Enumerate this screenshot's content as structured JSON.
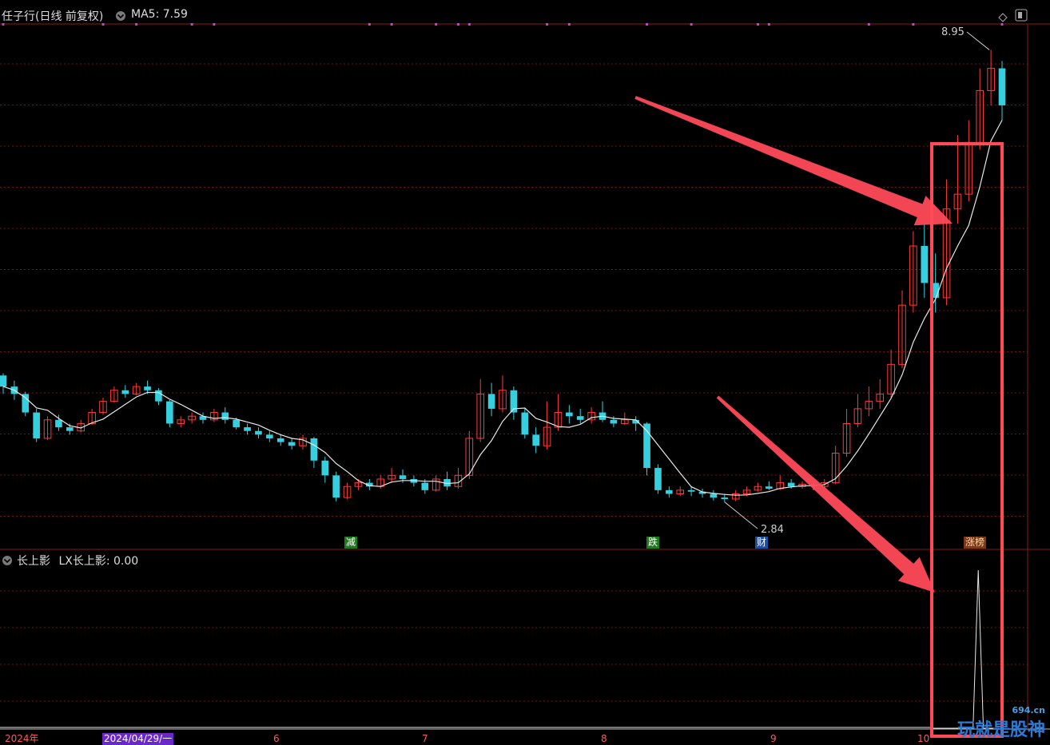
{
  "header": {
    "stock_title": "任子行(日线 前复权)",
    "ma_text": "MA5: 7.59"
  },
  "sub_header": {
    "indicator": "长上影",
    "value_text": "LX长上影: 0.00"
  },
  "annotations": {
    "high_label": "8.95",
    "low_label": "2.84"
  },
  "event_tags": [
    {
      "text": "减",
      "bg": "#1f7a1f",
      "color": "#ffffff"
    },
    {
      "text": "跌",
      "bg": "#1f7a1f",
      "color": "#ffffff"
    },
    {
      "text": "财",
      "bg": "#1f4fa0",
      "color": "#ffffff"
    },
    {
      "text": "涨榜",
      "bg": "#7a3a1a",
      "color": "#ffd0a0"
    }
  ],
  "date_axis": {
    "year": "2024年",
    "cursor": "2024/04/29/一",
    "months": [
      "6",
      "7",
      "8",
      "9",
      "10"
    ]
  },
  "watermark": {
    "site": "694.cn",
    "text": "玩就是股神"
  },
  "colors": {
    "up": "#ff3a3a",
    "down": "#34d0e0",
    "ma": "#e8e8e8",
    "highlight": "#ff4a5a",
    "grid": "#7a1010",
    "cursor_bg": "#6a28c8",
    "signal_dot": "#d040d0"
  },
  "chart_data": [
    {
      "type": "candlestick",
      "title": "任子行(日线 前复权)",
      "series": [
        {
          "name": "MA5",
          "last_value": 7.59
        },
        {
          "name": "K线",
          "values": [
            [
              4.55,
              4.4,
              4.58,
              4.3
            ],
            [
              4.4,
              4.3,
              4.48,
              4.22
            ],
            [
              4.3,
              4.05,
              4.33,
              4.0
            ],
            [
              4.05,
              3.7,
              4.1,
              3.65
            ],
            [
              3.7,
              3.95,
              4.0,
              3.68
            ],
            [
              3.95,
              3.85,
              4.02,
              3.8
            ],
            [
              3.85,
              3.8,
              3.9,
              3.75
            ],
            [
              3.8,
              3.9,
              3.95,
              3.78
            ],
            [
              3.9,
              4.05,
              4.1,
              3.88
            ],
            [
              4.05,
              4.2,
              4.25,
              4.02
            ],
            [
              4.2,
              4.35,
              4.4,
              4.18
            ],
            [
              4.35,
              4.3,
              4.42,
              4.25
            ],
            [
              4.3,
              4.4,
              4.45,
              4.28
            ],
            [
              4.4,
              4.35,
              4.48,
              4.3
            ],
            [
              4.35,
              4.2,
              4.38,
              4.15
            ],
            [
              4.2,
              3.9,
              4.22,
              3.85
            ],
            [
              3.9,
              3.95,
              4.0,
              3.85
            ],
            [
              3.95,
              4.0,
              4.05,
              3.9
            ],
            [
              4.0,
              3.95,
              4.05,
              3.9
            ],
            [
              3.95,
              4.05,
              4.1,
              3.92
            ],
            [
              4.05,
              3.95,
              4.12,
              3.9
            ],
            [
              3.95,
              3.85,
              3.98,
              3.82
            ],
            [
              3.85,
              3.8,
              3.9,
              3.75
            ],
            [
              3.8,
              3.75,
              3.85,
              3.7
            ],
            [
              3.75,
              3.7,
              3.8,
              3.65
            ],
            [
              3.7,
              3.65,
              3.75,
              3.6
            ],
            [
              3.65,
              3.6,
              3.7,
              3.55
            ],
            [
              3.6,
              3.7,
              3.75,
              3.55
            ],
            [
              3.7,
              3.4,
              3.72,
              3.3
            ],
            [
              3.4,
              3.2,
              3.45,
              3.1
            ],
            [
              3.2,
              2.9,
              3.25,
              2.85
            ],
            [
              2.9,
              3.05,
              3.1,
              2.88
            ],
            [
              3.05,
              3.1,
              3.15,
              3.0
            ],
            [
              3.1,
              3.05,
              3.15,
              3.0
            ],
            [
              3.05,
              3.15,
              3.2,
              3.02
            ],
            [
              3.15,
              3.2,
              3.3,
              3.1
            ],
            [
              3.2,
              3.15,
              3.28,
              3.1
            ],
            [
              3.15,
              3.1,
              3.2,
              3.05
            ],
            [
              3.1,
              3.0,
              3.15,
              2.95
            ],
            [
              3.0,
              3.15,
              3.2,
              2.98
            ],
            [
              3.15,
              3.05,
              3.25,
              3.0
            ],
            [
              3.05,
              3.2,
              3.3,
              3.02
            ],
            [
              3.2,
              3.7,
              3.8,
              3.15
            ],
            [
              3.7,
              4.3,
              4.5,
              3.65
            ],
            [
              4.3,
              4.1,
              4.45,
              4.0
            ],
            [
              4.1,
              4.35,
              4.55,
              4.05
            ],
            [
              4.35,
              4.05,
              4.4,
              3.95
            ],
            [
              4.05,
              3.75,
              4.1,
              3.7
            ],
            [
              3.75,
              3.6,
              3.85,
              3.5
            ],
            [
              3.6,
              3.85,
              4.2,
              3.55
            ],
            [
              3.85,
              4.05,
              4.3,
              3.8
            ],
            [
              4.05,
              4.0,
              4.15,
              3.9
            ],
            [
              4.0,
              3.95,
              4.1,
              3.9
            ],
            [
              3.95,
              4.05,
              4.12,
              3.9
            ],
            [
              4.05,
              3.95,
              4.2,
              3.92
            ],
            [
              3.95,
              3.9,
              4.0,
              3.85
            ],
            [
              3.9,
              3.95,
              4.05,
              3.88
            ],
            [
              3.95,
              3.9,
              4.0,
              3.8
            ],
            [
              3.9,
              3.3,
              3.92,
              3.2
            ],
            [
              3.3,
              3.0,
              3.35,
              2.95
            ],
            [
              3.0,
              2.95,
              3.05,
              2.9
            ],
            [
              2.95,
              3.0,
              3.05,
              2.92
            ],
            [
              3.0,
              2.98,
              3.05,
              2.92
            ],
            [
              2.98,
              2.95,
              3.02,
              2.9
            ],
            [
              2.95,
              2.9,
              3.0,
              2.86
            ],
            [
              2.9,
              2.88,
              2.95,
              2.84
            ],
            [
              2.88,
              2.95,
              3.0,
              2.85
            ],
            [
              2.95,
              3.0,
              3.05,
              2.92
            ],
            [
              3.0,
              3.05,
              3.1,
              2.98
            ],
            [
              3.05,
              3.02,
              3.12,
              3.0
            ],
            [
              3.02,
              3.1,
              3.2,
              3.0
            ],
            [
              3.1,
              3.05,
              3.15,
              3.02
            ],
            [
              3.05,
              3.08,
              3.12,
              3.02
            ],
            [
              3.08,
              3.05,
              3.12,
              3.0
            ],
            [
              3.05,
              3.1,
              3.15,
              3.02
            ],
            [
              3.1,
              3.5,
              3.6,
              3.08
            ],
            [
              3.5,
              3.9,
              4.1,
              3.45
            ],
            [
              3.9,
              4.1,
              4.3,
              3.85
            ],
            [
              4.1,
              4.2,
              4.4,
              4.0
            ],
            [
              4.2,
              4.3,
              4.5,
              4.1
            ],
            [
              4.3,
              4.7,
              4.9,
              4.25
            ],
            [
              4.7,
              5.5,
              5.7,
              4.65
            ],
            [
              5.5,
              6.3,
              6.5,
              5.4
            ],
            [
              6.3,
              5.8,
              6.6,
              5.6
            ],
            [
              5.8,
              5.6,
              6.2,
              5.4
            ],
            [
              5.6,
              6.8,
              7.2,
              5.5
            ],
            [
              6.8,
              7.0,
              7.8,
              6.6
            ],
            [
              7.0,
              7.7,
              8.0,
              6.9
            ],
            [
              7.7,
              8.4,
              8.7,
              7.6
            ],
            [
              8.4,
              8.7,
              8.95,
              8.2
            ],
            [
              8.7,
              8.2,
              8.8,
              8.0
            ]
          ]
        }
      ],
      "ylim": [
        2.2,
        9.3
      ],
      "x_ticks": [
        "2024年",
        "6",
        "7",
        "8",
        "9",
        "10"
      ],
      "high": 8.95,
      "low": 2.84
    },
    {
      "type": "line",
      "title": "长上影",
      "series": [
        {
          "name": "LX长上影",
          "last_value": 0.0,
          "values": [
            0,
            0,
            0,
            0,
            0,
            0,
            0,
            0,
            0,
            1,
            0,
            0,
            0,
            0
          ]
        }
      ],
      "ylim": [
        0,
        1.0
      ]
    }
  ]
}
